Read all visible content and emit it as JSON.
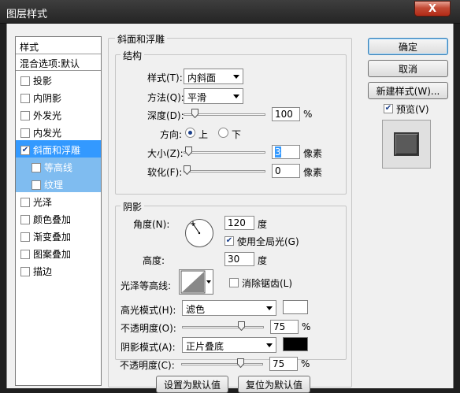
{
  "window": {
    "title": "图层样式",
    "close_label": "X"
  },
  "style_list": {
    "header": "样式",
    "blend_options": "混合选项:默认",
    "items": [
      {
        "label": "投影",
        "checked": false
      },
      {
        "label": "内阴影",
        "checked": false
      },
      {
        "label": "外发光",
        "checked": false
      },
      {
        "label": "内发光",
        "checked": false
      },
      {
        "label": "斜面和浮雕",
        "checked": true
      },
      {
        "label": "等高线",
        "checked": false
      },
      {
        "label": "纹理",
        "checked": false
      },
      {
        "label": "光泽",
        "checked": false
      },
      {
        "label": "颜色叠加",
        "checked": false
      },
      {
        "label": "渐变叠加",
        "checked": false
      },
      {
        "label": "图案叠加",
        "checked": false
      },
      {
        "label": "描边",
        "checked": false
      }
    ]
  },
  "panel": {
    "title": "斜面和浮雕"
  },
  "structure": {
    "title": "结构",
    "style_label": "样式(T):",
    "style_value": "内斜面",
    "technique_label": "方法(Q):",
    "technique_value": "平滑",
    "depth_label": "深度(D):",
    "depth_value": "100",
    "depth_unit": "%",
    "depth_fraction": 0.1,
    "direction_label": "方向:",
    "direction_up": "上",
    "direction_down": "下",
    "size_label": "大小(Z):",
    "size_value": "3",
    "size_unit": "像素",
    "size_fraction": 0.02,
    "soften_label": "软化(F):",
    "soften_value": "0",
    "soften_unit": "像素",
    "soften_fraction": 0.0
  },
  "shading": {
    "title": "阴影",
    "angle_label": "角度(N):",
    "angle_value": "120",
    "angle_unit": "度",
    "global_light_label": "使用全局光(G)",
    "global_light_checked": true,
    "altitude_label": "高度:",
    "altitude_value": "30",
    "altitude_unit": "度",
    "gloss_contour_label": "光泽等高线:",
    "anti_alias_label": "消除锯齿(L)",
    "anti_alias_checked": false,
    "highlight_mode_label": "高光模式(H):",
    "highlight_mode_value": "滤色",
    "highlight_color": "#ffffff",
    "highlight_opacity_label": "不透明度(O):",
    "highlight_opacity_value": "75",
    "highlight_opacity_unit": "%",
    "highlight_opacity_fraction": 0.75,
    "shadow_mode_label": "阴影模式(A):",
    "shadow_mode_value": "正片叠底",
    "shadow_color": "#000000",
    "shadow_opacity_label": "不透明度(C):",
    "shadow_opacity_value": "75",
    "shadow_opacity_unit": "%",
    "shadow_opacity_fraction": 0.75
  },
  "footer": {
    "make_default": "设置为默认值",
    "reset_default": "复位为默认值"
  },
  "actions": {
    "ok": "确定",
    "cancel": "取消",
    "new_style": "新建样式(W)...",
    "preview_label": "预览(V)",
    "preview_checked": true
  }
}
